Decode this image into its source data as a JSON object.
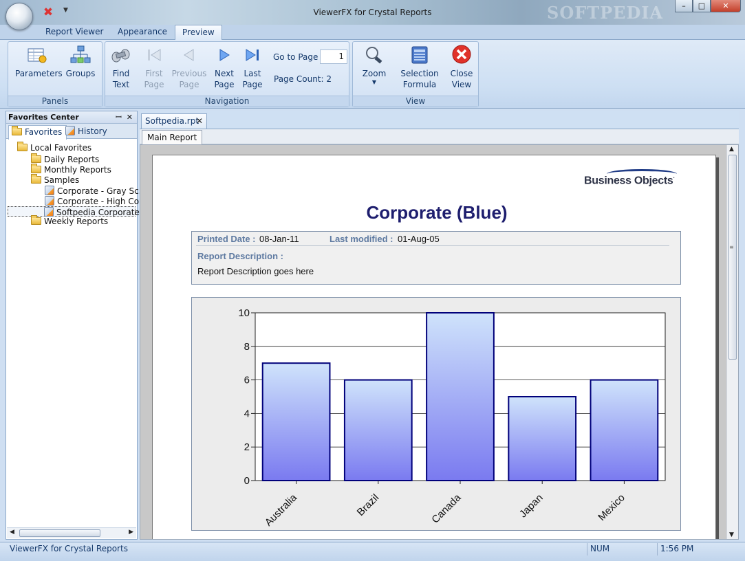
{
  "window": {
    "title": "ViewerFX for Crystal Reports",
    "watermark": "SOFTPEDIA",
    "minimize": "–",
    "maximize": "□",
    "close": "✕"
  },
  "ribbon_tabs": [
    {
      "label": "Report Viewer",
      "active": false
    },
    {
      "label": "Appearance",
      "active": false
    },
    {
      "label": "Preview",
      "active": true
    }
  ],
  "ribbon": {
    "panels": {
      "label": "Panels",
      "parameters": "Parameters",
      "groups": "Groups"
    },
    "navigation": {
      "label": "Navigation",
      "find": [
        "Find",
        "Text"
      ],
      "first": [
        "First",
        "Page"
      ],
      "previous": [
        "Previous",
        "Page"
      ],
      "next": [
        "Next",
        "Page"
      ],
      "last": [
        "Last",
        "Page"
      ],
      "goto_label": "Go to Page",
      "goto_value": "1",
      "page_count": "Page Count: 2"
    },
    "view": {
      "label": "View",
      "zoom": "Zoom",
      "selection": [
        "Selection",
        "Formula"
      ],
      "close": [
        "Close",
        "View"
      ]
    }
  },
  "favorites": {
    "title": "Favorites Center",
    "pin": "ꟷ",
    "close": "✕",
    "tabs": [
      "Favorites",
      "History"
    ],
    "tree": {
      "root": "Local Favorites",
      "daily": "Daily Reports",
      "monthly": "Monthly Reports",
      "samples": "Samples",
      "sample_items": [
        "Corporate - Gray Sc...",
        "Corporate - High Co...",
        "Softpedia  Corporate..."
      ],
      "weekly": "Weekly Reports"
    }
  },
  "document": {
    "tab": "Softpedia.rpt",
    "subtab": "Main Report"
  },
  "report": {
    "logo": "Business Objects",
    "title": "Corporate (Blue)",
    "printed_label": "Printed Date :",
    "printed_value": "08-Jan-11",
    "modified_label": "Last modified :",
    "modified_value": "01-Aug-05",
    "desc_label": "Report Description :",
    "desc_value": "Report Description goes here"
  },
  "chart_data": {
    "type": "bar",
    "categories": [
      "Australia",
      "Brazil",
      "Canada",
      "Japan",
      "Mexico"
    ],
    "values": [
      7,
      6,
      10,
      5,
      6
    ],
    "ylim": [
      0,
      10
    ],
    "yticks": [
      0,
      2,
      4,
      6,
      8,
      10
    ],
    "title": "",
    "xlabel": "",
    "ylabel": "",
    "grid": true,
    "bar_color_top": "#cfe3fb",
    "bar_color_bottom": "#7a7af0",
    "bar_border": "#00007a"
  },
  "status": {
    "text": "ViewerFX for Crystal Reports",
    "num": "NUM",
    "time": "1:56 PM"
  }
}
